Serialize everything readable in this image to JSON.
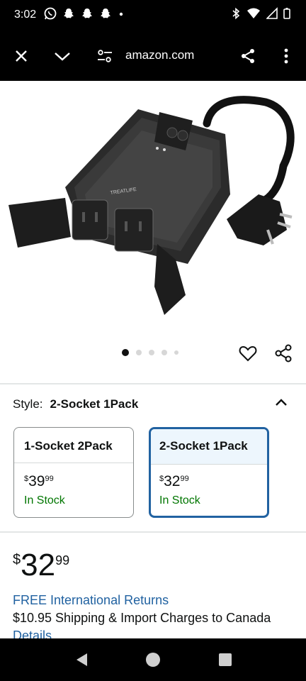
{
  "status_bar": {
    "time": "3:02",
    "left_icons": [
      "whatsapp-icon",
      "snapchat-icon",
      "snapchat-icon",
      "snapchat-icon",
      "notification-dot-icon"
    ],
    "right_icons": [
      "bluetooth-icon",
      "wifi-icon",
      "signal-icon",
      "battery-icon"
    ]
  },
  "toolbar": {
    "url": "amazon.com",
    "icons": [
      "close-icon",
      "chevron-down-icon",
      "site-settings-icon",
      "share-icon",
      "more-vert-icon"
    ]
  },
  "gallery": {
    "image_count": 5,
    "active_index": 0,
    "actions": [
      "heart-icon",
      "share-icon"
    ],
    "brand_text": "TREATLIFE"
  },
  "style": {
    "label": "Style:",
    "selected": "2-Socket 1Pack",
    "options": [
      {
        "name": "1-Socket 2Pack",
        "currency": "$",
        "whole": "39",
        "fraction": "99",
        "stock": "In Stock",
        "selected": false
      },
      {
        "name": "2-Socket 1Pack",
        "currency": "$",
        "whole": "32",
        "fraction": "99",
        "stock": "In Stock",
        "selected": true
      }
    ]
  },
  "price": {
    "currency": "$",
    "whole": "32",
    "fraction": "99"
  },
  "delivery": {
    "returns": "FREE International Returns",
    "shipping": "$10.95 Shipping & Import Charges to Canada",
    "details_link": "Details"
  },
  "colors": {
    "link": "#2162a1",
    "in_stock": "#007600",
    "selected_border": "#2162a1",
    "selected_bg": "#edf6fd",
    "text": "#0f1111"
  }
}
